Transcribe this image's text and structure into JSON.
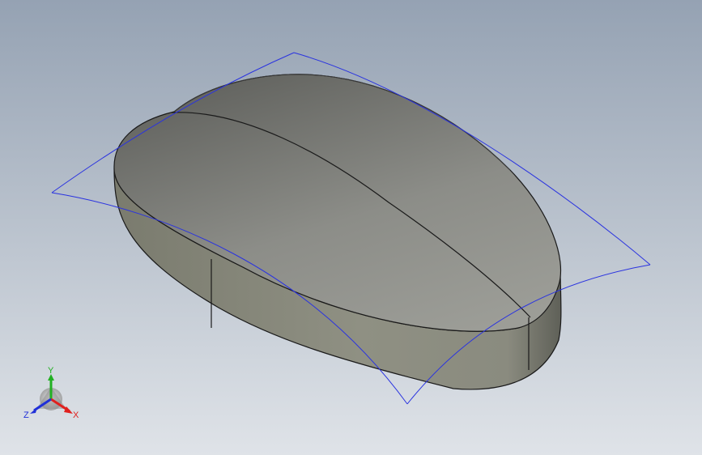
{
  "viewport": {
    "background_top": "#95a2b3",
    "background_bottom": "#dfe3e8"
  },
  "model": {
    "body_color": "#878982",
    "top_face_light": "#9a9b95",
    "top_face_dark": "#62635f",
    "side_face_light": "#8e8f82",
    "side_face_dark": "#66675d",
    "edge_color": "#1a1a1a"
  },
  "surface_plane": {
    "color": "#2a33e0"
  },
  "triad": {
    "x_label": "X",
    "y_label": "Y",
    "z_label": "Z",
    "x_color": "#e0201e",
    "y_color": "#22b022",
    "z_color": "#2030d8"
  }
}
